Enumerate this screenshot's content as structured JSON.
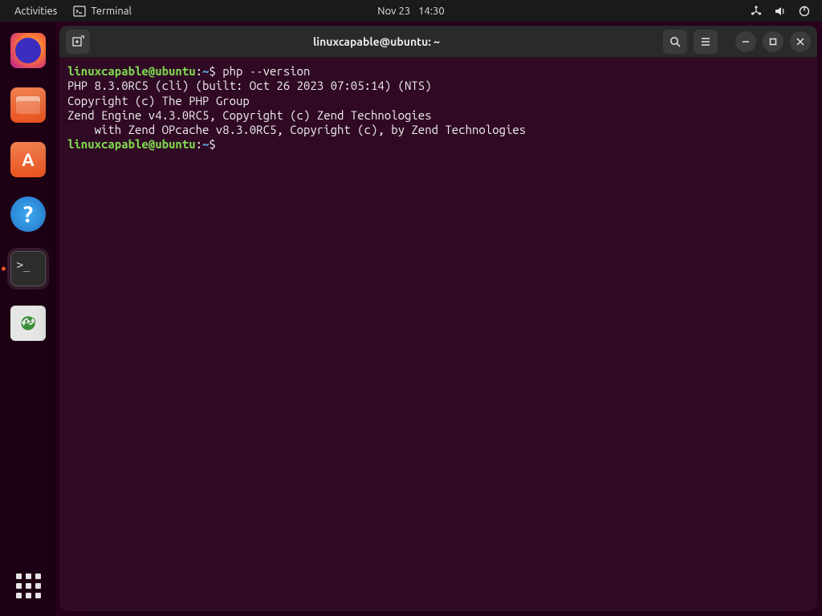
{
  "topbar": {
    "activities": "Activities",
    "app_label": "Terminal",
    "date": "Nov 23",
    "time": "14:30"
  },
  "dock": {
    "items": [
      {
        "name": "firefox",
        "label": "Firefox"
      },
      {
        "name": "files",
        "label": "Files"
      },
      {
        "name": "software",
        "label": "Ubuntu Software",
        "glyph": "A"
      },
      {
        "name": "help",
        "label": "Help",
        "glyph": "?"
      },
      {
        "name": "terminal",
        "label": "Terminal",
        "glyph": ">_",
        "active": true
      },
      {
        "name": "trash",
        "label": "Trash"
      }
    ]
  },
  "window": {
    "title": "linuxcapable@ubuntu: ~"
  },
  "terminal": {
    "prompt": {
      "user": "linuxcapable@ubuntu",
      "sep": ":",
      "path": "~",
      "symbol": "$"
    },
    "command1": "php --version",
    "output": [
      "PHP 8.3.0RC5 (cli) (built: Oct 26 2023 07:05:14) (NTS)",
      "Copyright (c) The PHP Group",
      "Zend Engine v4.3.0RC5, Copyright (c) Zend Technologies",
      "    with Zend OPcache v8.3.0RC5, Copyright (c), by Zend Technologies"
    ],
    "command2": ""
  }
}
